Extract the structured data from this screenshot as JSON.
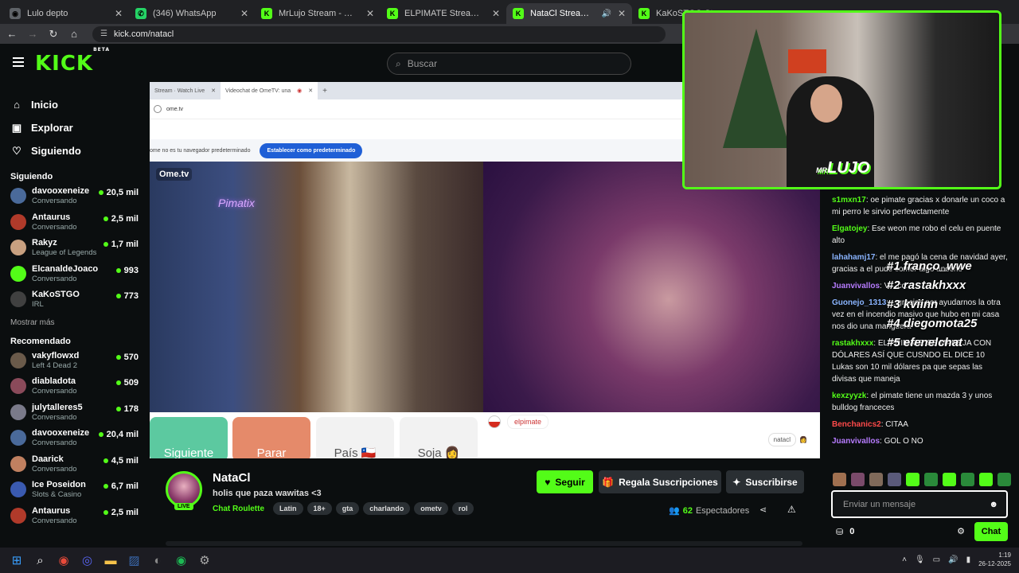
{
  "browser": {
    "tabs": [
      {
        "title": "Lulo depto",
        "icon": "globe-icon",
        "color": "#5f6368"
      },
      {
        "title": "(346) WhatsApp",
        "icon": "whatsapp-icon",
        "color": "#25d366"
      },
      {
        "title": "MrLujo Stream - Watch Live on",
        "icon": "kick-icon",
        "color": "#53fc18"
      },
      {
        "title": "ELPIMATE Stream - Watch Live",
        "icon": "kick-icon",
        "color": "#53fc18"
      },
      {
        "title": "NataCl Stream - Watch Live",
        "icon": "kick-icon",
        "color": "#53fc18",
        "active": true
      },
      {
        "title": "KaKoSTGO Stream - Watch Live",
        "icon": "kick-icon",
        "color": "#53fc18"
      }
    ],
    "url": "kick.com/natacl"
  },
  "header": {
    "logo": "KICK",
    "logo_badge": "BETA",
    "search_placeholder": "Buscar"
  },
  "sidebar": {
    "nav": [
      {
        "label": "Inicio",
        "icon": "home-icon"
      },
      {
        "label": "Explorar",
        "icon": "compass-icon"
      },
      {
        "label": "Siguiendo",
        "icon": "heart-icon"
      }
    ],
    "following_title": "Siguiendo",
    "following": [
      {
        "name": "davooxeneize",
        "sub": "Conversando",
        "count": "20,5 mil",
        "color": "#4a6a9a"
      },
      {
        "name": "Antaurus",
        "sub": "Conversando",
        "count": "2,5 mil",
        "color": "#b03a2a"
      },
      {
        "name": "Rakyz",
        "sub": "League of Legends",
        "count": "1,7 mil",
        "color": "#c8a080"
      },
      {
        "name": "ElcanaldeJoaco",
        "sub": "Conversando",
        "count": "993",
        "color": "#53fc18"
      },
      {
        "name": "KaKoSTGO",
        "sub": "IRL",
        "count": "773",
        "color": "#404040"
      }
    ],
    "show_more": "Mostrar más",
    "recommended_title": "Recomendado",
    "recommended": [
      {
        "name": "vakyflowxd",
        "sub": "Left 4 Dead 2",
        "count": "570",
        "color": "#6a5a4a"
      },
      {
        "name": "diabladota",
        "sub": "Conversando",
        "count": "509",
        "color": "#8a4a5a"
      },
      {
        "name": "julytalleres5",
        "sub": "Conversando",
        "count": "178",
        "color": "#7a7a8a"
      },
      {
        "name": "davooxeneize",
        "sub": "Conversando",
        "count": "20,4 mil",
        "color": "#4a6a9a"
      },
      {
        "name": "Daarick",
        "sub": "Conversando",
        "count": "4,5 mil",
        "color": "#c08060"
      },
      {
        "name": "Ice Poseidon",
        "sub": "Slots & Casino",
        "count": "6,7 mil",
        "color": "#3a5ab0"
      },
      {
        "name": "Antaurus",
        "sub": "Conversando",
        "count": "2,5 mil",
        "color": "#b03a2a"
      }
    ]
  },
  "video": {
    "inner_tabs": [
      "Stream · Watch Live",
      "Videochat de OmeTV: una"
    ],
    "inner_url": "ome.tv",
    "default_notice": "ome no es tu navegador predeterminado",
    "default_button": "Establecer como predeterminado",
    "ometv_logo": "Ome.tv",
    "neon_sign": "Pimatix",
    "buttons": [
      {
        "label": "Siguiente",
        "color": "#5cc9a0"
      },
      {
        "label": "Parar",
        "color": "#e58a6a"
      },
      {
        "label": "País 🇨🇱",
        "color": "#f2f2f2",
        "text": "#555"
      },
      {
        "label": "Soja 👩",
        "color": "#f2f2f2",
        "text": "#555"
      }
    ],
    "chat_user": "elpimate",
    "partner_tag": "natacl",
    "webcam_name": "LUJO",
    "webcam_badge": "MR"
  },
  "chat": {
    "messages": [
      {
        "user": "s1mxn17",
        "color": "#53fc18",
        "text": "oe pimate gracias x donarle un coco a mi perro le sirvio perfewctamente"
      },
      {
        "user": "Elgatojey",
        "color": "#53fc18",
        "text": "Ese weon me robo el celu en puente alto"
      },
      {
        "user": "lahahamj17",
        "color": "#8ab4ff",
        "text": "el me pagó la cena de navidad ayer, gracias a el pude comer algo anoche"
      },
      {
        "user": "Juanvivallos",
        "color": "#b77cff",
        "text": "V... cc..."
      },
      {
        "user": "Guonejo_1313",
        "color": "#8ab4ff",
        "text": "...gracias por ayudarnos la otra vez en el incendio masivo que hubo en mi casa nos dio una manguera"
      },
      {
        "user": "rastakhxxx",
        "color": "#53fc18",
        "text": "EL PRIMATE SE MANEJA CON DÓLARES ASÍ QUE CUSNDO EL DICE 10 Lukas son 10 mil dólares pa que sepas las divisas que maneja"
      },
      {
        "user": "kexzyyzk",
        "color": "#53fc18",
        "text": "el pimate tiene un mazda 3 y unos bulldog franceces"
      },
      {
        "user": "Benchanics2",
        "color": "#ff4a4a",
        "text": "CITAA"
      },
      {
        "user": "Juanvivallos",
        "color": "#b77cff",
        "text": "GOL O NO"
      }
    ],
    "ranking": [
      "#1 franco_wwe",
      "#2 rastakhxxx",
      "#3 kviinn",
      "#4 diegomota25",
      "#5 efenelchat"
    ],
    "input_placeholder": "Enviar un mensaje",
    "points": "0",
    "send_label": "Chat"
  },
  "stream": {
    "name": "NataCl",
    "title": "holis que paza wawitas <3",
    "category": "Chat Roulette",
    "tags": [
      "Latin",
      "18+",
      "gta",
      "charlando",
      "ometv",
      "rol"
    ],
    "live_label": "LIVE",
    "follow_label": "Seguir",
    "gift_label": "Regala Suscripciones",
    "subscribe_label": "Suscribirse",
    "viewers_count": "62",
    "viewers_label": "Espectadores"
  },
  "taskbar": {
    "time": "1:19",
    "date": "26-12-2025",
    "apps": [
      {
        "name": "windows-start-icon",
        "color": "#3aa0ff"
      },
      {
        "name": "search-icon",
        "color": "#ffffff"
      },
      {
        "name": "chrome-icon",
        "color": "#e84a3a"
      },
      {
        "name": "discord-icon",
        "color": "#5865f2"
      },
      {
        "name": "file-explorer-icon",
        "color": "#f5c24a"
      },
      {
        "name": "visual-studio-icon",
        "color": "#3a6ab0"
      },
      {
        "name": "steam-icon",
        "color": "#888"
      },
      {
        "name": "spotify-icon",
        "color": "#1db954"
      },
      {
        "name": "settings-icon",
        "color": "#aaa"
      }
    ]
  }
}
